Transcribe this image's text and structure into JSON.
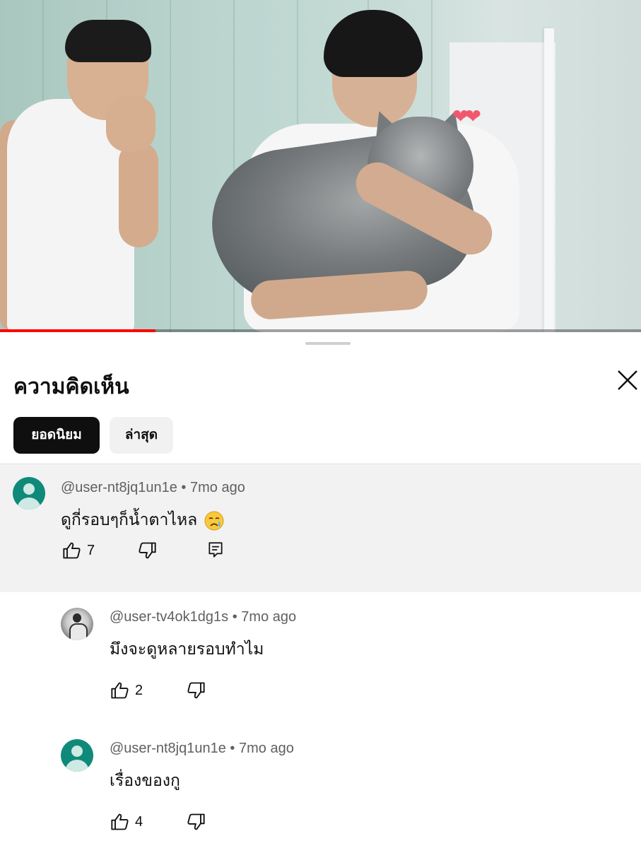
{
  "video": {
    "progress": 0.243,
    "hearts_sticker": "❤❤"
  },
  "sheet": {
    "title": "ความคิดเห็น",
    "close_icon": "close-icon",
    "chips": [
      {
        "label": "ยอดนิยม",
        "selected": true
      },
      {
        "label": "ล่าสุด",
        "selected": false
      }
    ]
  },
  "comments": [
    {
      "author": "@user-nt8jq1un1e",
      "time": "7mo ago",
      "text": "ดูกี่รอบๆก็น้ำตาไหล",
      "emoji": "crying-face-emoji",
      "likes": "7",
      "avatar": "default-teal",
      "has_reply_button": true
    },
    {
      "author": "@user-tv4ok1dg1s",
      "time": "7mo ago",
      "text": "มึงจะดูหลายรอบทำไม",
      "likes": "2",
      "avatar": "photo"
    },
    {
      "author": "@user-nt8jq1un1e",
      "time": "7mo ago",
      "text": "เรื่องของกู",
      "likes": "4",
      "avatar": "default-teal"
    }
  ],
  "colors": {
    "accent": "#ff0000",
    "avatar_teal": "#0f8a7a",
    "chip_active_bg": "#0f0f0f",
    "chip_inactive_bg": "#f1f1f1",
    "highlight_bg": "#f2f2f2",
    "meta_text": "#606060"
  }
}
